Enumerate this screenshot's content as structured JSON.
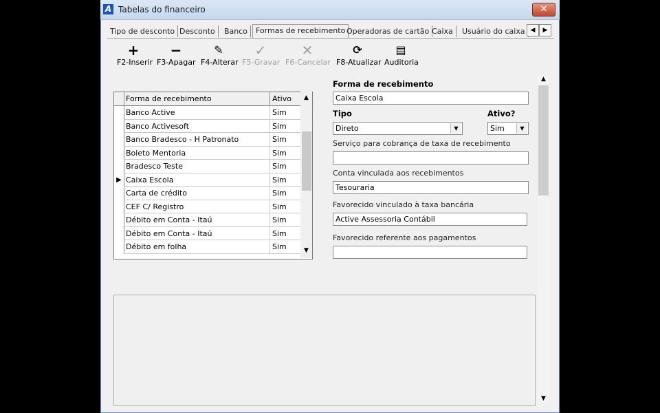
{
  "window": {
    "title": "Tabelas do financeiro",
    "close_label": "✕"
  },
  "tabs": [
    {
      "label": "Tipo de desconto"
    },
    {
      "label": "Desconto"
    },
    {
      "label": "Banco"
    },
    {
      "label": "Formas de recebimento"
    },
    {
      "label": "Operadoras de cartão"
    },
    {
      "label": "Caixa"
    },
    {
      "label": "Usuário do caixa"
    }
  ],
  "toolbar": {
    "insert": {
      "icon": "+",
      "label": "F2-Inserir"
    },
    "delete": {
      "icon": "−",
      "label": "F3-Apagar"
    },
    "edit": {
      "icon": "✎",
      "label": "F4-Alterar"
    },
    "save": {
      "icon": "✓",
      "label": "F5-Gravar"
    },
    "cancel": {
      "icon": "✕",
      "label": "F6-Cancelar"
    },
    "refresh": {
      "icon": "⟳",
      "label": "F8-Atualizar"
    },
    "audit": {
      "icon": "▤",
      "label": "Auditoria"
    }
  },
  "grid": {
    "columns": [
      "Forma de recebimento",
      "Ativo"
    ],
    "rows": [
      {
        "name": "Banco Active",
        "ativo": "Sim"
      },
      {
        "name": "Banco Activesoft",
        "ativo": "Sim"
      },
      {
        "name": "Banco Bradesco - H Patronato",
        "ativo": "Sim"
      },
      {
        "name": "Boleto Mentoria",
        "ativo": "Sim"
      },
      {
        "name": "Bradesco Teste",
        "ativo": "Sim"
      },
      {
        "name": "Caixa Escola",
        "ativo": "Sim"
      },
      {
        "name": "Carta de crédito",
        "ativo": "Sim"
      },
      {
        "name": "CEF C/ Registro",
        "ativo": "Sim"
      },
      {
        "name": "Débito em Conta - Itaú",
        "ativo": "Sim"
      },
      {
        "name": "Débito em Conta - Itaú",
        "ativo": "Sim"
      },
      {
        "name": "Débito em folha",
        "ativo": "Sim"
      }
    ],
    "current_row_marker": "▶"
  },
  "form": {
    "forma_label": "Forma de recebimento",
    "forma_value": "Caixa Escola",
    "tipo_label": "Tipo",
    "tipo_value": "Direto",
    "ativo_label": "Ativo?",
    "ativo_value": "Sim",
    "servico_label": "Serviço para cobrança de taxa de recebimento",
    "servico_value": "",
    "conta_label": "Conta vinculada aos recebimentos",
    "conta_value": "Tesouraria",
    "favorecido_taxa_label": "Favorecido vinculado à taxa bancária",
    "favorecido_taxa_value": "Active Assessoria Contábil",
    "favorecido_pag_label": "Favorecido referente aos pagamentos",
    "favorecido_pag_value": ""
  },
  "scroll_glyphs": {
    "up": "▲",
    "down": "▼",
    "left": "◀",
    "right": "▶",
    "dd": "▼"
  }
}
